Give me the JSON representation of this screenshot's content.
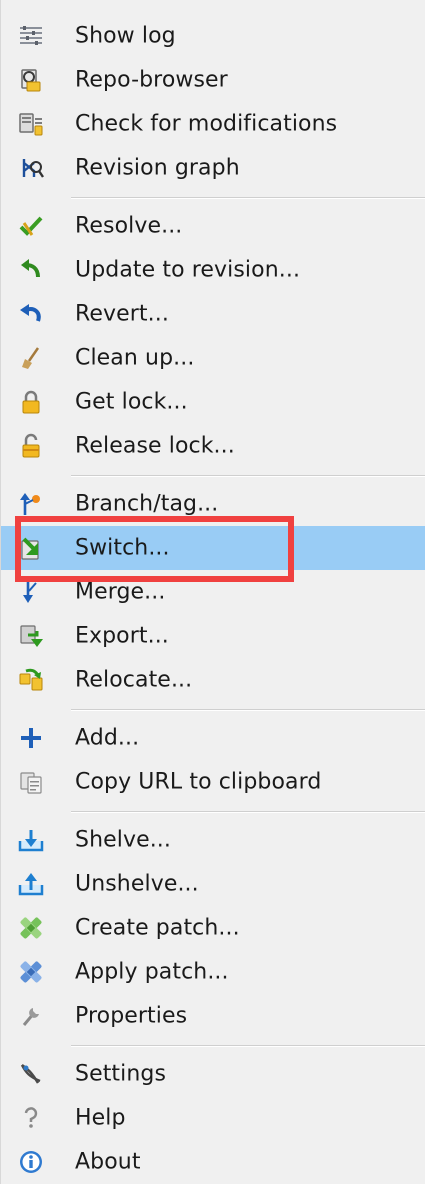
{
  "menu": {
    "items": [
      {
        "label": "Show log",
        "icon": "show-log-icon"
      },
      {
        "label": "Repo-browser",
        "icon": "repo-browser-icon"
      },
      {
        "label": "Check for modifications",
        "icon": "check-modifications-icon"
      },
      {
        "label": "Revision graph",
        "icon": "revision-graph-icon"
      },
      {
        "label": "Resolve...",
        "icon": "resolve-icon"
      },
      {
        "label": "Update to revision...",
        "icon": "update-revision-icon"
      },
      {
        "label": "Revert...",
        "icon": "revert-icon"
      },
      {
        "label": "Clean up...",
        "icon": "clean-up-icon"
      },
      {
        "label": "Get lock...",
        "icon": "get-lock-icon"
      },
      {
        "label": "Release lock...",
        "icon": "release-lock-icon"
      },
      {
        "label": "Branch/tag...",
        "icon": "branch-tag-icon"
      },
      {
        "label": "Switch...",
        "icon": "switch-icon",
        "selected": true
      },
      {
        "label": "Merge...",
        "icon": "merge-icon"
      },
      {
        "label": "Export...",
        "icon": "export-icon"
      },
      {
        "label": "Relocate...",
        "icon": "relocate-icon"
      },
      {
        "label": "Add...",
        "icon": "add-icon"
      },
      {
        "label": "Copy URL to clipboard",
        "icon": "copy-url-icon"
      },
      {
        "label": "Shelve...",
        "icon": "shelve-icon"
      },
      {
        "label": "Unshelve...",
        "icon": "unshelve-icon"
      },
      {
        "label": "Create patch...",
        "icon": "create-patch-icon"
      },
      {
        "label": "Apply patch...",
        "icon": "apply-patch-icon"
      },
      {
        "label": "Properties",
        "icon": "properties-icon"
      },
      {
        "label": "Settings",
        "icon": "settings-icon"
      },
      {
        "label": "Help",
        "icon": "help-icon"
      },
      {
        "label": "About",
        "icon": "about-icon"
      }
    ]
  },
  "colors": {
    "menu_background": "#f0f0f0",
    "selected_background": "#99ccf5",
    "highlight_border": "#f04140"
  }
}
